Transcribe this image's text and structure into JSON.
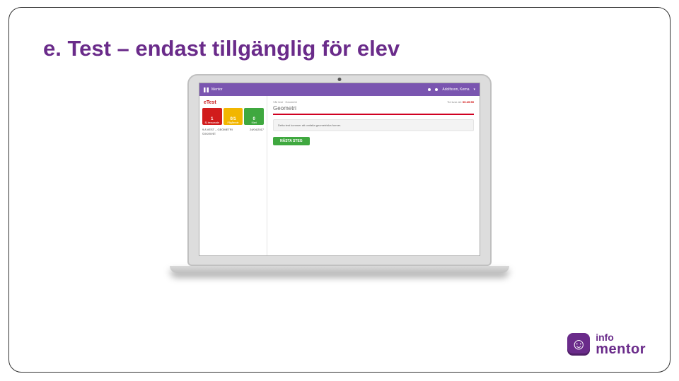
{
  "slide": {
    "title": "e. Test – endast tillgänglig för elev"
  },
  "appbar": {
    "brand": "Mentor",
    "user_name": "Adolfsson, Kerna"
  },
  "sidebar": {
    "etest_label": "eTest",
    "cards": [
      {
        "count": "1",
        "label": "Ej besvarade"
      },
      {
        "count": "0/1",
        "label": "Pågående"
      },
      {
        "count": "0",
        "label": "Klart"
      }
    ],
    "items": [
      {
        "line1": "9 A VEST – GEOMETRI",
        "date": "24/04/2017",
        "line2": "Geometri"
      }
    ]
  },
  "main": {
    "crumb": "Vår test · Geometri",
    "time_label": "Tid kvar att: ",
    "time_value": "00:49:59",
    "title": "Geometri",
    "info": "Detta test kommer att omfatta geometriska former.",
    "next_button": "NÄSTA STEG"
  },
  "logo": {
    "line1": "info",
    "line2": "mentor",
    "mark": "☺"
  }
}
